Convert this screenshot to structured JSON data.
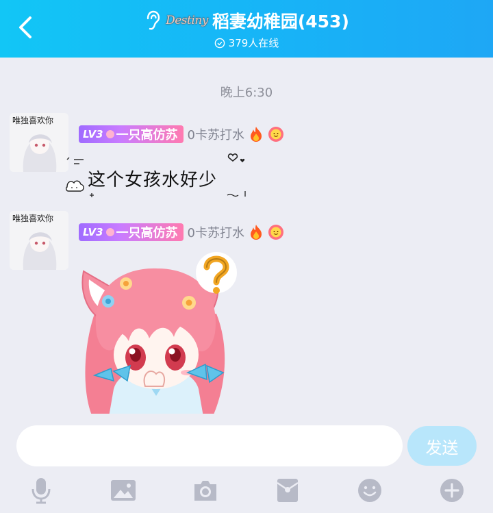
{
  "header": {
    "back_icon": "chevron-left-icon",
    "group_icon": "ear-icon",
    "logo_text": "Destiny",
    "title": "稻妻幼稚园(453)",
    "online_icon": "check-circle-icon",
    "online_text": "379人在线"
  },
  "chat": {
    "timestamp": "晚上6:30",
    "messages": [
      {
        "avatar_text": "唯独喜欢你",
        "level": "LV3",
        "nickname": "一只高仿苏",
        "title_tag": "0卡苏打水",
        "text": "这个女孩水好少"
      },
      {
        "avatar_text": "唯独喜欢你",
        "level": "LV3",
        "nickname": "一只高仿苏",
        "title_tag": "0卡苏打水",
        "sticker": "anime-girl-question-sticker"
      }
    ]
  },
  "composer": {
    "placeholder": "",
    "send_label": "发送",
    "tools": [
      "microphone-icon",
      "image-icon",
      "camera-icon",
      "red-packet-icon",
      "emoji-icon",
      "plus-icon"
    ]
  },
  "colors": {
    "header_start": "#12c6f6",
    "header_end": "#1ea7f5",
    "background": "#ecedf4",
    "send_button": "#b8e6fb",
    "tool_icon": "#b7bac7"
  }
}
